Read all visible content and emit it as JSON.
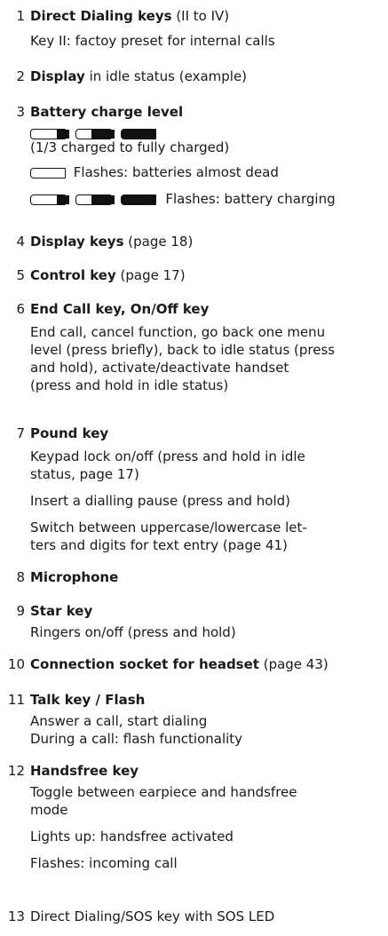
{
  "items": [
    {
      "num": "1",
      "bold": "Direct Dialing keys",
      "rest": " (II to IV)",
      "lines": [
        "Key II: factoy preset for internal calls"
      ]
    },
    {
      "num": "2",
      "bold": "Display",
      "rest": " in idle status (example)",
      "lines": []
    },
    {
      "num": "3",
      "bold": "Battery charge level",
      "rest": "",
      "lines": []
    },
    {
      "num": "4",
      "bold": "Display keys",
      "rest": " (page 18)",
      "lines": []
    },
    {
      "num": "5",
      "bold": "Control key",
      "rest": " (page 17)",
      "lines": []
    },
    {
      "num": "6",
      "bold": "End Call key, On/Off key",
      "rest": "",
      "lines": [
        "End call, cancel function, go back one menu",
        "level (press briefly), back to idle status (press",
        "and hold), activate/deactivate handset",
        "(press and hold in idle status)"
      ]
    },
    {
      "num": "7",
      "bold": "Pound key",
      "rest": "",
      "paras": [
        [
          "Keypad lock on/off (press and hold in idle",
          "status, page 17)"
        ],
        [
          "Insert a dialling pause (press and hold)"
        ],
        [
          "Switch between uppercase/lowercase let-",
          "ters and digits for text entry (page 41)"
        ]
      ]
    },
    {
      "num": "8",
      "bold": "Microphone",
      "rest": "",
      "lines": []
    },
    {
      "num": "9",
      "bold": "Star key",
      "rest": "",
      "lines": [
        "Ringers on/off (press and hold)"
      ]
    },
    {
      "num": "10",
      "bold": "Connection socket for headset",
      "rest": " (page 43)",
      "lines": []
    },
    {
      "num": "11",
      "bold": "Talk key / Flash",
      "rest": "",
      "lines": [
        "Answer a call, start dialing",
        "During a call: flash functionality"
      ]
    },
    {
      "num": "12",
      "bold": "Handsfree key",
      "rest": "",
      "paras": [
        [
          "Toggle between earpiece and handsfree",
          "mode"
        ],
        [
          "Lights up: handsfree activated"
        ],
        [
          "Flashes: incoming call"
        ]
      ]
    },
    {
      "num": "13",
      "bold": "",
      "rest": "Direct Dialing/SOS key with SOS LED",
      "lines": []
    }
  ],
  "battery": {
    "caption": "(1/3 charged to fully charged)",
    "dead_text": "Flashes: batteries almost dead",
    "charging_text": "Flashes: battery charging",
    "levels": [
      0.33,
      0.66,
      1.0
    ]
  }
}
